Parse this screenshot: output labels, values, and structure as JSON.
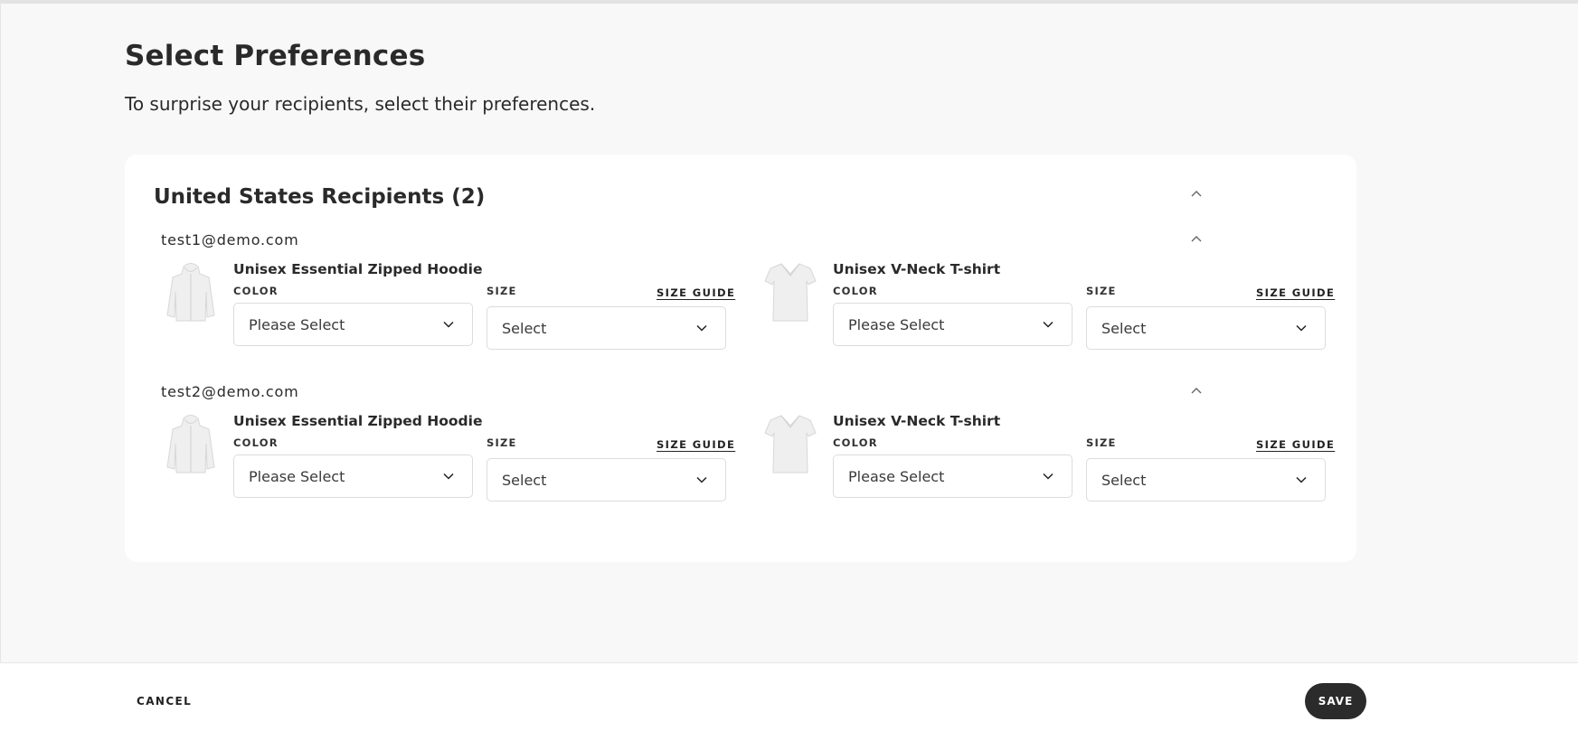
{
  "page": {
    "title": "Select Preferences",
    "subtitle": "To surprise your recipients, select their preferences."
  },
  "group": {
    "title": "United States Recipients (2)",
    "collapse_icon": "chevron-up-icon"
  },
  "recipients": [
    {
      "email": "test1@demo.com",
      "products": [
        {
          "name": "Unisex Essential Zipped Hoodie",
          "image_icon": "hoodie-icon",
          "color_label": "COLOR",
          "color_value": "Please Select",
          "size_label": "SIZE",
          "size_value": "Select",
          "size_guide": "SIZE GUIDE"
        },
        {
          "name": "Unisex V-Neck T-shirt",
          "image_icon": "tshirt-icon",
          "color_label": "COLOR",
          "color_value": "Please Select",
          "size_label": "SIZE",
          "size_value": "Select",
          "size_guide": "SIZE GUIDE"
        }
      ]
    },
    {
      "email": "test2@demo.com",
      "products": [
        {
          "name": "Unisex Essential Zipped Hoodie",
          "image_icon": "hoodie-icon",
          "color_label": "COLOR",
          "color_value": "Please Select",
          "size_label": "SIZE",
          "size_value": "Select",
          "size_guide": "SIZE GUIDE"
        },
        {
          "name": "Unisex V-Neck T-shirt",
          "image_icon": "tshirt-icon",
          "color_label": "COLOR",
          "color_value": "Please Select",
          "size_label": "SIZE",
          "size_value": "Select",
          "size_guide": "SIZE GUIDE"
        }
      ]
    }
  ],
  "footer": {
    "cancel_label": "CANCEL",
    "save_label": "SAVE"
  },
  "colors": {
    "page_background": "#f8f8f8",
    "card_background": "#ffffff",
    "save_button": "#2b2b2b",
    "text": "#2a2a2a"
  }
}
